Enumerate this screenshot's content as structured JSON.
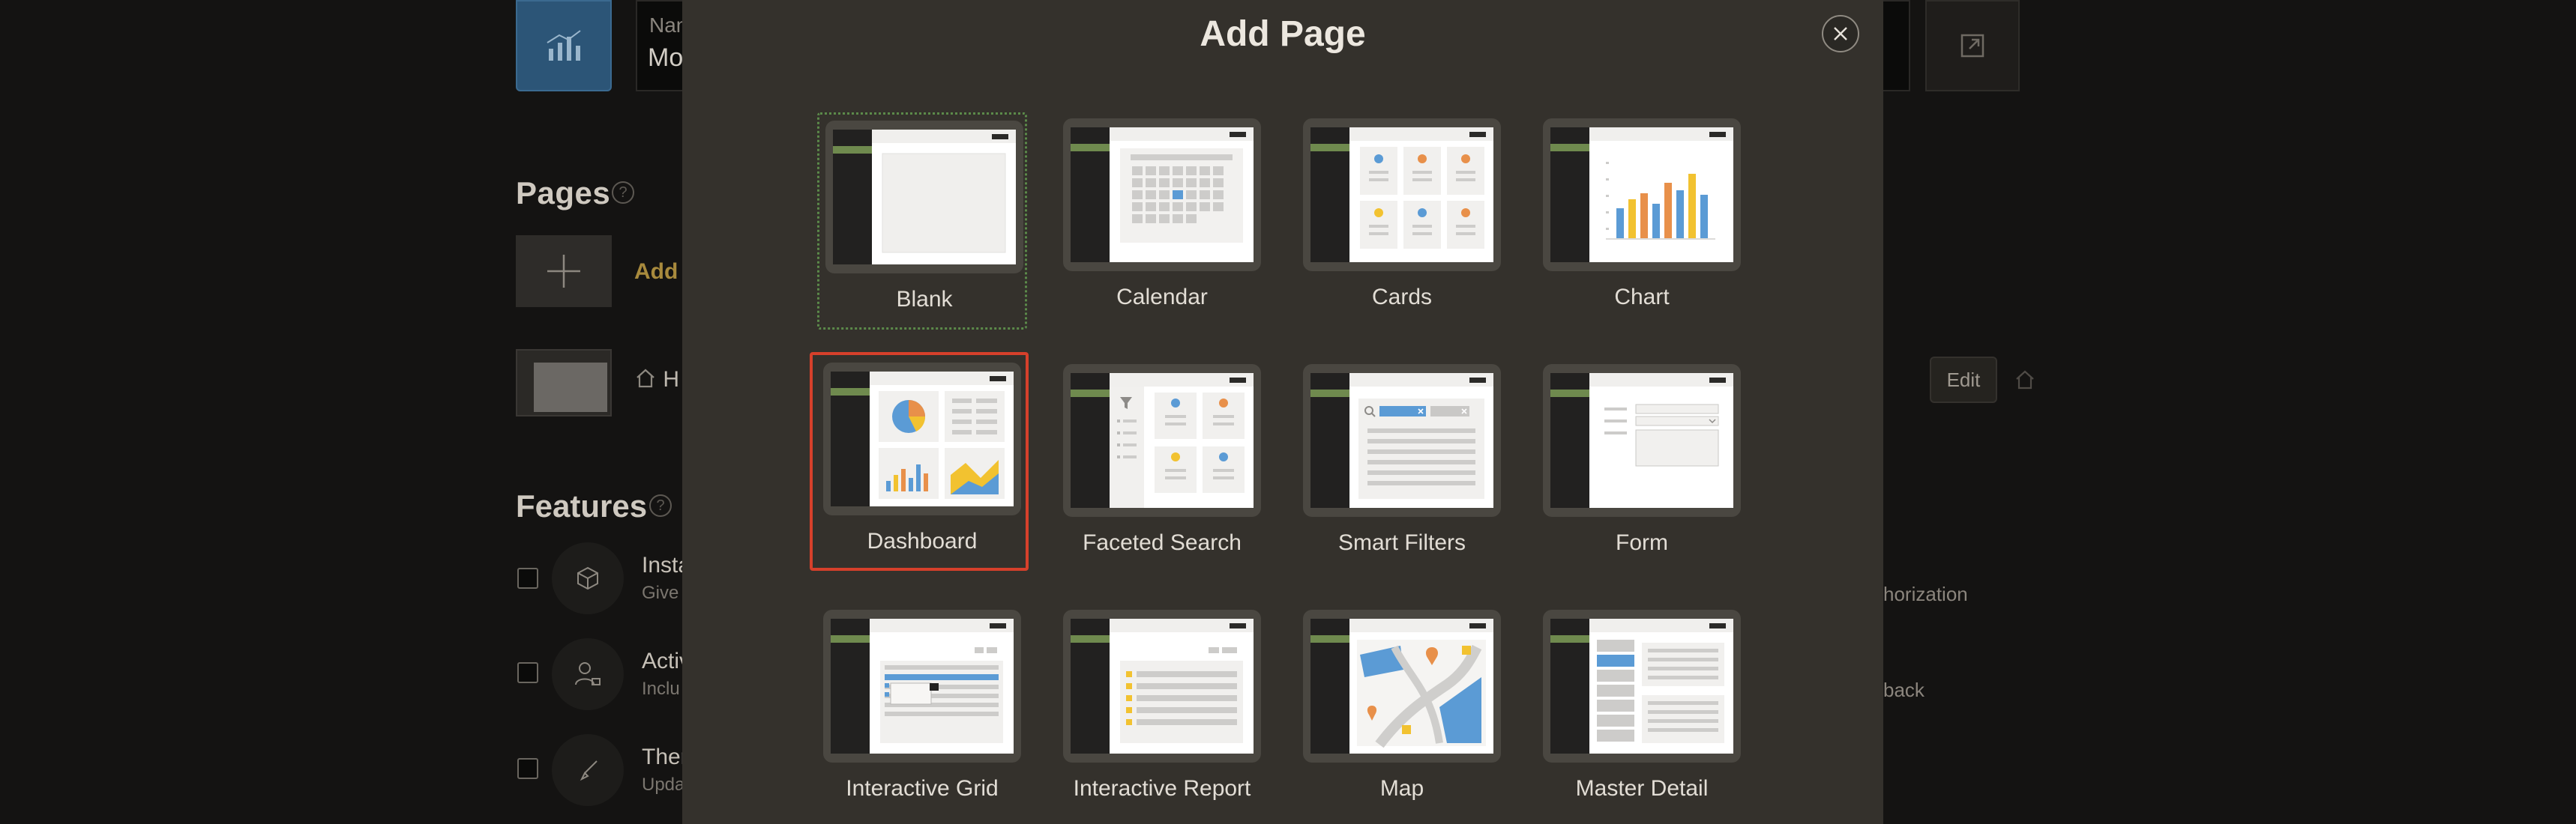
{
  "background": {
    "name_label": "Nam",
    "name_value": "Mo",
    "pages_heading": "Pages",
    "help_glyph": "?",
    "add_page_link": "Add",
    "home_page_item": "H",
    "edit_button": "Edit",
    "features_heading": "Features",
    "features": [
      {
        "title": "Insta",
        "subtitle": "Give",
        "icon": "package-icon"
      },
      {
        "title": "Activ",
        "subtitle": "Inclu",
        "icon": "user-lock-icon"
      },
      {
        "title": "Ther",
        "subtitle": "Upda",
        "icon": "brush-icon"
      }
    ],
    "right_texts": [
      "horization",
      "back"
    ]
  },
  "modal": {
    "title": "Add Page",
    "close_icon": "close-icon",
    "tiles": [
      {
        "label": "Blank",
        "selected": false
      },
      {
        "label": "Calendar",
        "selected": false
      },
      {
        "label": "Cards",
        "selected": false
      },
      {
        "label": "Chart",
        "selected": false
      },
      {
        "label": "Dashboard",
        "selected": true
      },
      {
        "label": "Faceted Search",
        "selected": false
      },
      {
        "label": "Smart Filters",
        "selected": false
      },
      {
        "label": "Form",
        "selected": false
      },
      {
        "label": "Interactive Grid",
        "selected": false
      },
      {
        "label": "Interactive Report",
        "selected": false
      },
      {
        "label": "Map",
        "selected": false
      },
      {
        "label": "Master Detail",
        "selected": false
      }
    ]
  },
  "colors": {
    "accent_green": "#6f8a4e",
    "selection_red": "#d6402b",
    "chart_blue": "#5b9bd5",
    "chart_orange": "#e8904a",
    "chart_yellow": "#f2c230"
  }
}
